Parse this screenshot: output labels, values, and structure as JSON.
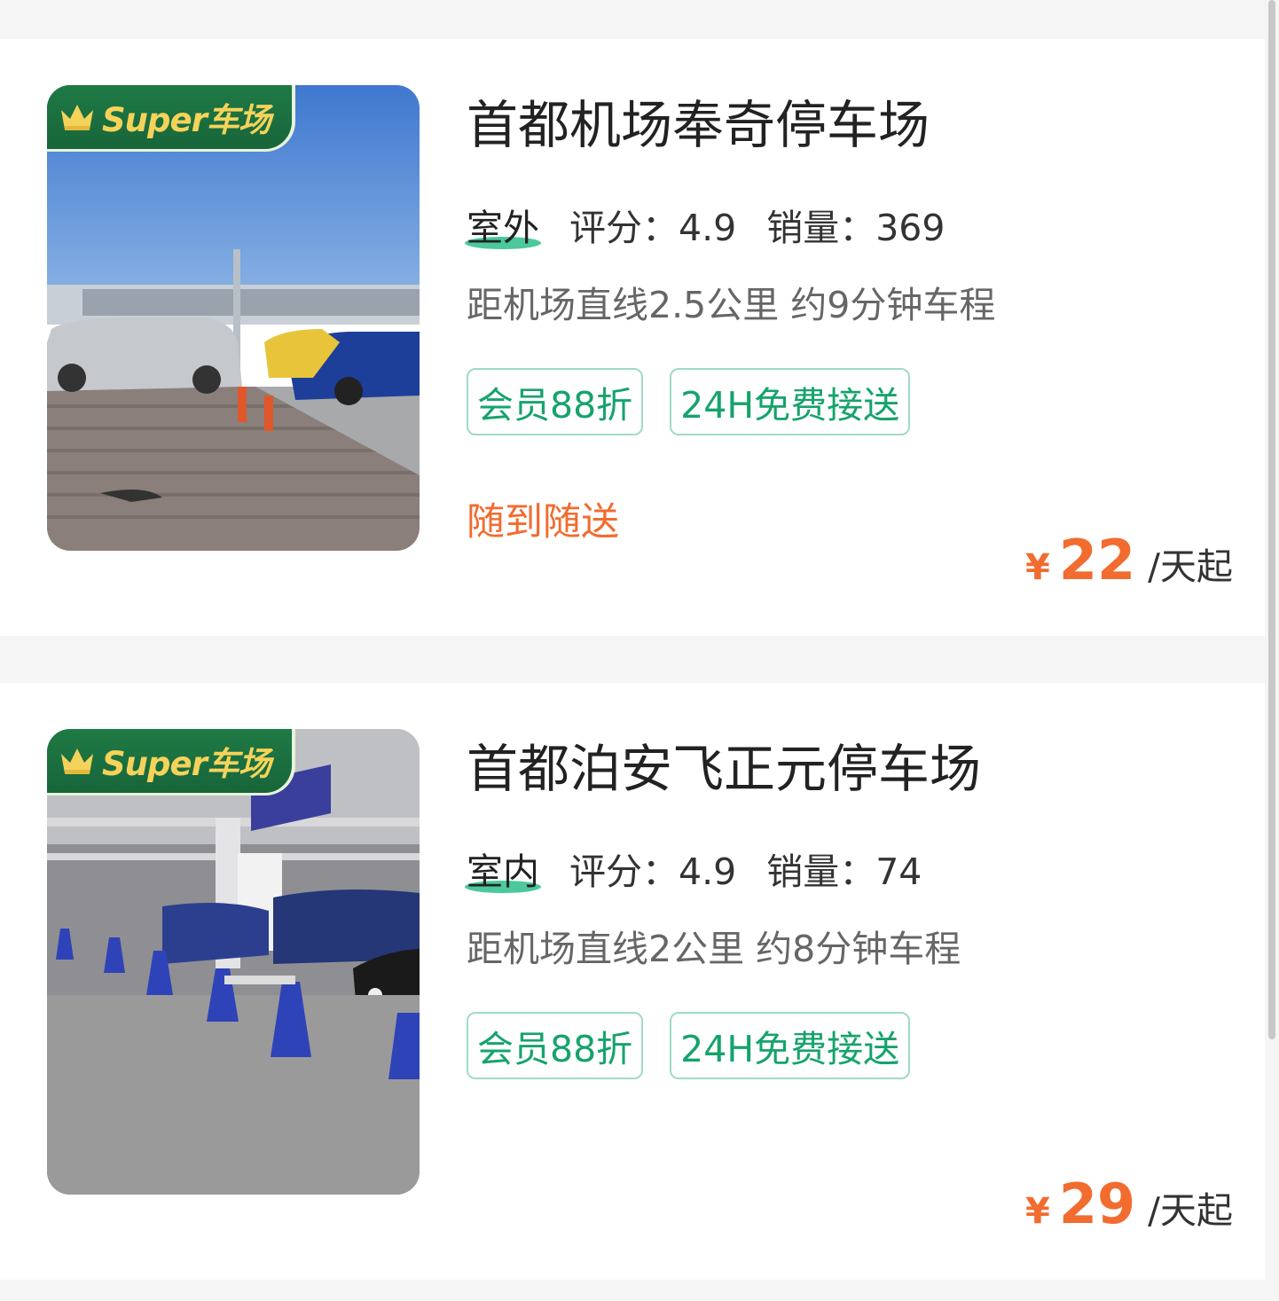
{
  "listings": [
    {
      "badge_text": "Super车场",
      "name": "首都机场奉奇停车场",
      "type": "室外",
      "rating_label": "评分：",
      "rating": "4.9",
      "sales_label": "销量：",
      "sales": "369",
      "distance": "距机场直线2.5公里 约9分钟车程",
      "tags": [
        "会员88折",
        "24H免费接送"
      ],
      "note": "随到随送",
      "currency": "¥",
      "price": "22",
      "price_unit": "/天起"
    },
    {
      "badge_text": "Super车场",
      "name": "首都泊安飞正元停车场",
      "type": "室内",
      "rating_label": "评分：",
      "rating": "4.9",
      "sales_label": "销量：",
      "sales": "74",
      "distance": "距机场直线2公里 约8分钟车程",
      "tags": [
        "会员88折",
        "24H免费接送"
      ],
      "note": "",
      "currency": "¥",
      "price": "29",
      "price_unit": "/天起"
    }
  ],
  "colors": {
    "accent_green": "#16a36b",
    "price_orange": "#f26b2f",
    "badge_green": "#1f7a45",
    "badge_gold": "#f5d35a"
  }
}
